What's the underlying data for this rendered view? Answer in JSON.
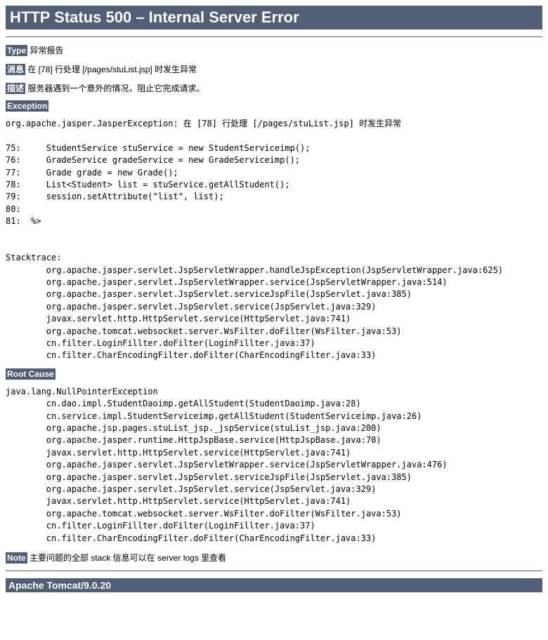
{
  "title": "HTTP Status 500 – Internal Server Error",
  "labels": {
    "type": "Type",
    "message": "消息",
    "description": "描述",
    "exception": "Exception",
    "rootcause": "Root Cause",
    "note": "Note"
  },
  "type_text": " 异常报告",
  "message_text": " 在 [78] 行处理 [/pages/stuList.jsp] 时发生异常",
  "description_text": " 服务器遇到一个意外的情况，阻止它完成请求。",
  "exception_pre": "org.apache.jasper.JasperException: 在 [78] 行处理 [/pages/stuList.jsp] 时发生异常\n\n75:     StudentService stuService = new StudentServiceimp();\n76:     GradeService gradeService = new GradeServiceimp();\n77:     Grade grade = new Grade();\n78:     List<Student> list = stuService.getAllStudent();\n79:     session.setAttribute(\"list\", list);\n80: \n81:  %>\n\n\nStacktrace:\n\torg.apache.jasper.servlet.JspServletWrapper.handleJspException(JspServletWrapper.java:625)\n\torg.apache.jasper.servlet.JspServletWrapper.service(JspServletWrapper.java:514)\n\torg.apache.jasper.servlet.JspServlet.serviceJspFile(JspServlet.java:385)\n\torg.apache.jasper.servlet.JspServlet.service(JspServlet.java:329)\n\tjavax.servlet.http.HttpServlet.service(HttpServlet.java:741)\n\torg.apache.tomcat.websocket.server.WsFilter.doFilter(WsFilter.java:53)\n\tcn.filter.LoginFillter.doFilter(LoginFillter.java:37)\n\tcn.filter.CharEncodingFilter.doFilter(CharEncodingFilter.java:33)",
  "rootcause_pre": "java.lang.NullPointerException\n\tcn.dao.impl.StudentDaoimp.getAllStudent(StudentDaoimp.java:28)\n\tcn.service.impl.StudentServiceimp.getAllStudent(StudentServiceimp.java:26)\n\torg.apache.jsp.pages.stuList_jsp._jspService(stuList_jsp.java:200)\n\torg.apache.jasper.runtime.HttpJspBase.service(HttpJspBase.java:70)\n\tjavax.servlet.http.HttpServlet.service(HttpServlet.java:741)\n\torg.apache.jasper.servlet.JspServletWrapper.service(JspServletWrapper.java:476)\n\torg.apache.jasper.servlet.JspServlet.serviceJspFile(JspServlet.java:385)\n\torg.apache.jasper.servlet.JspServlet.service(JspServlet.java:329)\n\tjavax.servlet.http.HttpServlet.service(HttpServlet.java:741)\n\torg.apache.tomcat.websocket.server.WsFilter.doFilter(WsFilter.java:53)\n\tcn.filter.LoginFillter.doFilter(LoginFillter.java:37)\n\tcn.filter.CharEncodingFilter.doFilter(CharEncodingFilter.java:33)",
  "note_text": " 主要问题的全部 stack 信息可以在 server logs 里查看",
  "footer": "Apache Tomcat/9.0.20"
}
